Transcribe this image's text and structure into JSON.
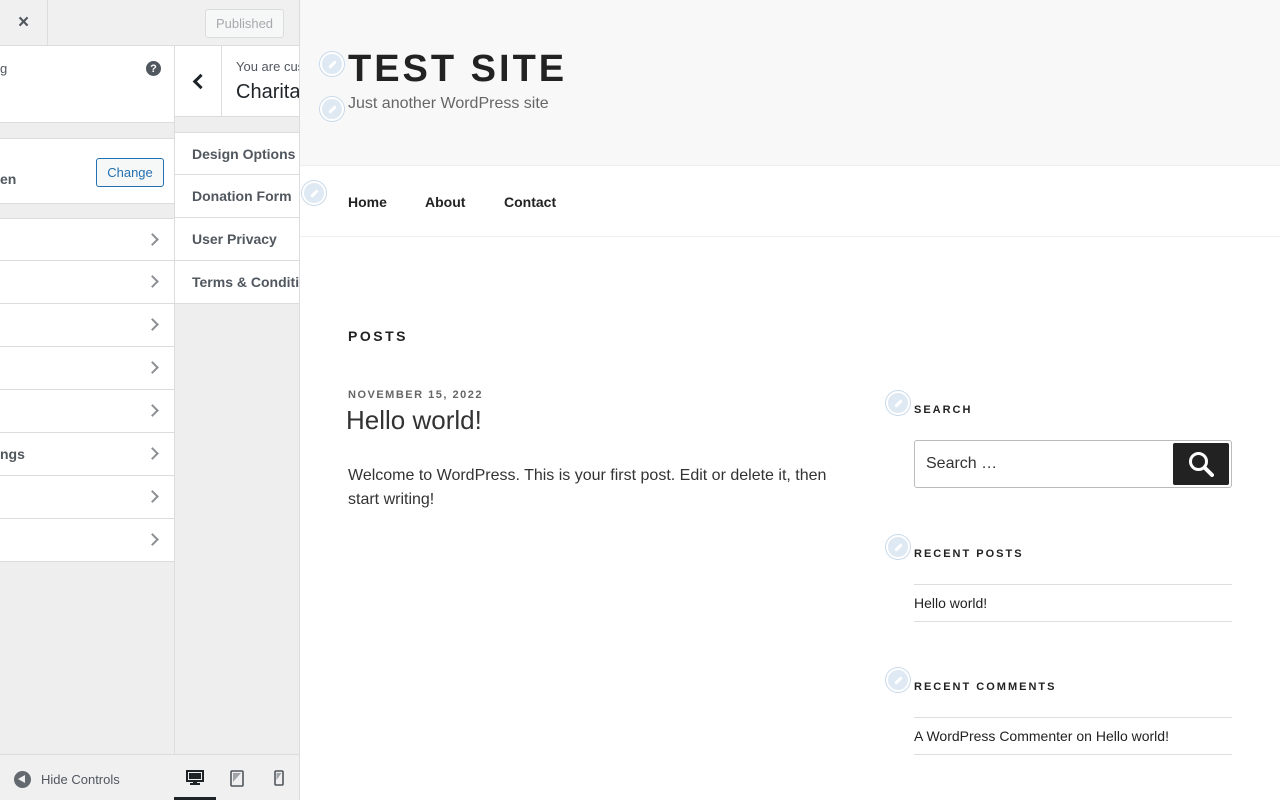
{
  "customizer": {
    "close_label": "×",
    "publish_label": "Published",
    "theme_info_cut": "g",
    "help_label": "?",
    "active_theme_cut": "en",
    "change_label": "Change",
    "root_sections": [
      "",
      "",
      "",
      "",
      "",
      "ngs",
      "",
      ""
    ],
    "panel": {
      "customizing_label": "You are customizing",
      "title": "Charitable",
      "sections": [
        "Design Options",
        "Donation Form",
        "User Privacy",
        "Terms & Conditions"
      ]
    },
    "footer": {
      "hide_controls_label": "Hide Controls",
      "devices": [
        "desktop",
        "tablet",
        "mobile"
      ],
      "active_device": "desktop"
    }
  },
  "site": {
    "title": "TEST SITE",
    "tagline": "Just another WordPress site",
    "nav": [
      "Home",
      "About",
      "Contact"
    ],
    "posts_heading": "POSTS",
    "post": {
      "date": "NOVEMBER 15, 2022",
      "title": "Hello world!",
      "excerpt": "Welcome to WordPress. This is your first post. Edit or delete it, then start writing!"
    },
    "widgets": {
      "search_title": "SEARCH",
      "search_placeholder": "Search …",
      "recent_posts_title": "RECENT POSTS",
      "recent_posts": [
        "Hello world!"
      ],
      "recent_comments_title": "RECENT COMMENTS",
      "comment_author": "A WordPress Commenter",
      "comment_on": "on",
      "comment_post": "Hello world!"
    }
  },
  "colors": {
    "accent": "#2271b1",
    "text": "#222222",
    "sidebar_bg": "#eeeeee"
  },
  "icons": {
    "close": "close-icon",
    "help": "help-icon",
    "chevron": "chevron-right-icon",
    "back": "chevron-left-icon",
    "collapse": "collapse-sidebar-icon",
    "edit": "edit-shortcut-icon",
    "search": "search-icon"
  }
}
